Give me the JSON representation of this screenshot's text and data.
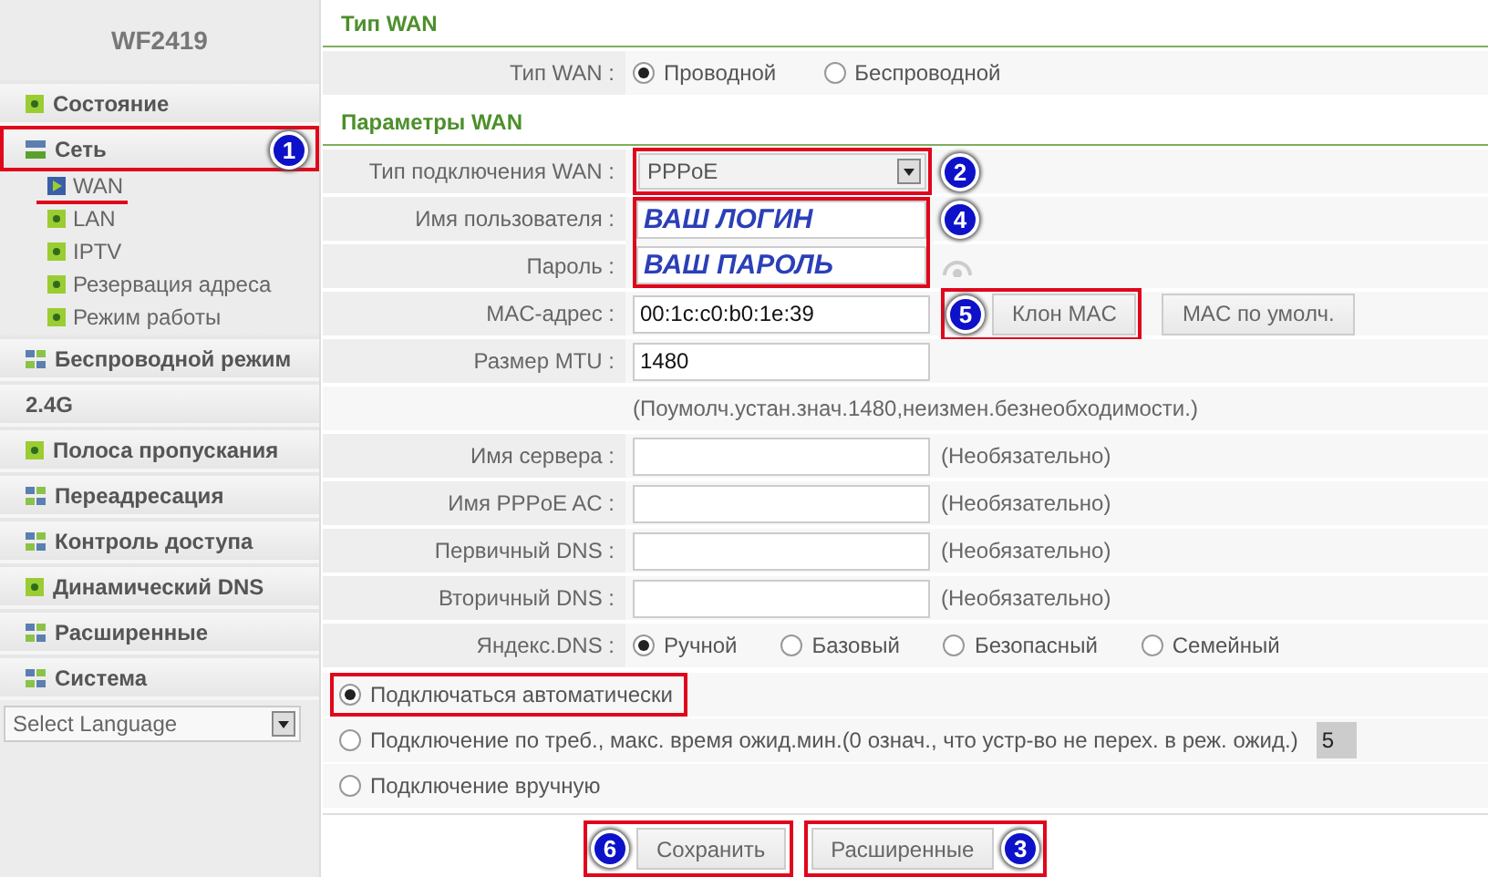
{
  "sidebar": {
    "title": "WF2419",
    "items": [
      {
        "label": "Состояние",
        "kind": "page",
        "outlined": false
      },
      {
        "label": "Сеть",
        "kind": "folder",
        "outlined": true,
        "badge": "1",
        "children": [
          {
            "label": "WAN",
            "selected": true,
            "underlined": true
          },
          {
            "label": "LAN",
            "selected": false,
            "underlined": false
          },
          {
            "label": "IPTV",
            "selected": false,
            "underlined": false
          },
          {
            "label": "Резервация адреса",
            "selected": false,
            "underlined": false
          },
          {
            "label": "Режим работы",
            "selected": false,
            "underlined": false
          }
        ]
      },
      {
        "label": "Беспроводной режим",
        "kind": "group",
        "outlined": false
      },
      {
        "label": "2.4G",
        "kind": "label",
        "outlined": false
      },
      {
        "label": "Полоса пропускания",
        "kind": "page",
        "outlined": false
      },
      {
        "label": "Переадресация",
        "kind": "group",
        "outlined": false
      },
      {
        "label": "Контроль доступа",
        "kind": "group",
        "outlined": false
      },
      {
        "label": "Динамический DNS",
        "kind": "page",
        "outlined": false
      },
      {
        "label": "Расширенные",
        "kind": "group",
        "outlined": false
      },
      {
        "label": "Система",
        "kind": "group",
        "outlined": false
      }
    ],
    "language_select": {
      "value": "Select Language"
    }
  },
  "wan_type": {
    "title": "Тип WAN",
    "label": "Тип WAN :",
    "options": [
      {
        "label": "Проводной",
        "selected": true
      },
      {
        "label": "Беспроводной",
        "selected": false
      }
    ]
  },
  "wan_params": {
    "title": "Параметры WAN",
    "rows": [
      {
        "kind": "select",
        "label": "Тип подключения WAN :",
        "value": "PPPoE",
        "outlined": true,
        "badge": "2"
      },
      {
        "kind": "credentials",
        "outlined": true,
        "fields": [
          {
            "label": "Имя пользователя :",
            "value": "ВАШ ЛОГИН",
            "badge": "4"
          },
          {
            "label": "Пароль :",
            "value": "ВАШ ПАРОЛЬ",
            "reveal_icon": true
          }
        ]
      },
      {
        "kind": "mac",
        "label": "MAC-адрес :",
        "value": "00:1c:c0:b0:1e:39",
        "buttons": [
          {
            "label": "Клон MAC",
            "outlined": true,
            "badge": "5"
          },
          {
            "label": "MAC по умолч.",
            "outlined": false
          }
        ]
      },
      {
        "kind": "input",
        "label": "Размер MTU :",
        "value": "1480"
      },
      {
        "kind": "note",
        "text": "(Поумолч.устан.знач.1480,неизмен.безнеобходимости.)"
      },
      {
        "kind": "input",
        "label": "Имя сервера :",
        "hint": "(Необязательно)"
      },
      {
        "kind": "input",
        "label": "Имя PPPoE AC :",
        "hint": "(Необязательно)"
      },
      {
        "kind": "input",
        "label": "Первичный DNS :",
        "hint": "(Необязательно)"
      },
      {
        "kind": "input",
        "label": "Вторичный DNS :",
        "hint": "(Необязательно)"
      },
      {
        "kind": "radios",
        "label": "Яндекс.DNS :",
        "options": [
          {
            "label": "Ручной",
            "selected": true
          },
          {
            "label": "Базовый",
            "selected": false
          },
          {
            "label": "Безопасный",
            "selected": false
          },
          {
            "label": "Семейный",
            "selected": false
          }
        ]
      }
    ]
  },
  "connect_modes": [
    {
      "label": "Подключаться автоматически",
      "selected": true,
      "outlined": true
    },
    {
      "label": "Подключение по треб., макс. время ожид.мин.(0 означ., что устр-во не перех. в реж. ожид.)",
      "selected": false,
      "outlined": false,
      "value": "5"
    },
    {
      "label": "Подключение вручную",
      "selected": false,
      "outlined": false
    }
  ],
  "buttons": [
    {
      "label": "Сохранить",
      "badge": "6"
    },
    {
      "label": "Расширенные",
      "badge": "3"
    }
  ]
}
